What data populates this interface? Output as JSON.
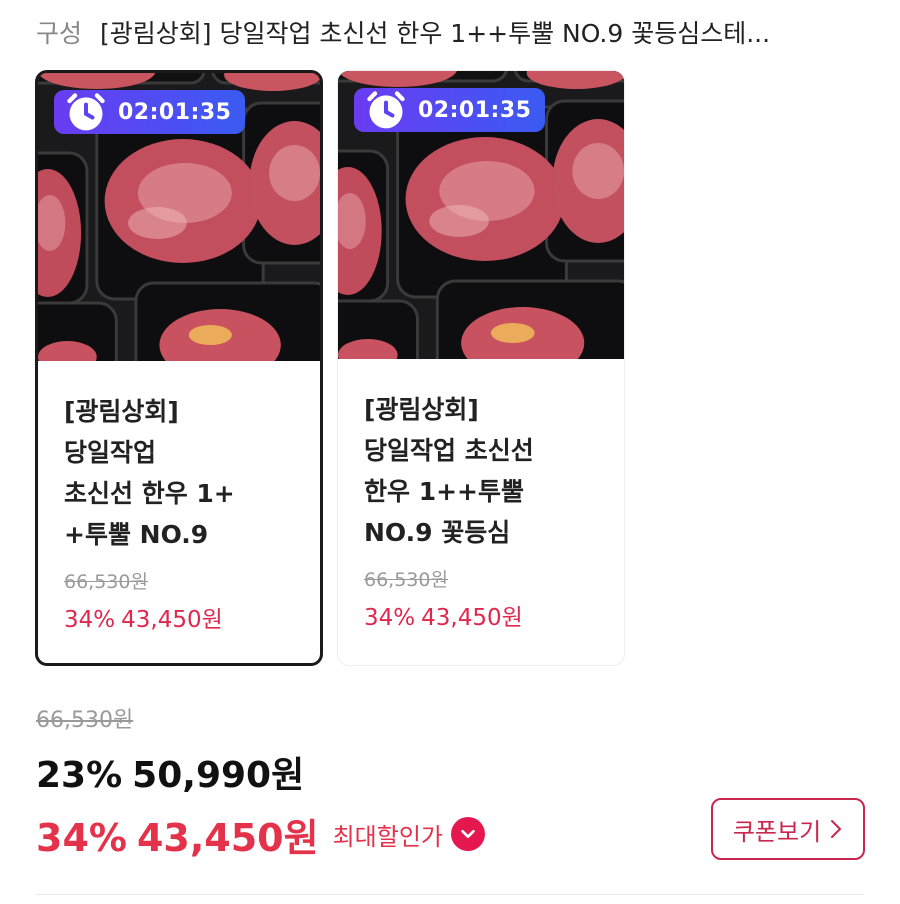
{
  "header": {
    "label": "구성",
    "title": "[광림상회] 당일작업 초신선 한우 1++투뿔 NO.9 꽃등심스테..."
  },
  "options": [
    {
      "timer": "02:01:35",
      "title_lines": [
        "[광림상회]",
        "당일작업",
        "초신선 한우 1+",
        "+투뿔 NO.9"
      ],
      "original_price": "66,530원",
      "discount_pct": "34%",
      "sale_price": "43,450원"
    },
    {
      "timer": "02:01:35",
      "title_lines": [
        "[광림상회]",
        "당일작업 초신선",
        "한우 1++투뿔",
        "NO.9 꽃등심"
      ],
      "original_price": "66,530원",
      "discount_pct": "34%",
      "sale_price": "43,450원"
    }
  ],
  "pricing": {
    "original_price": "66,530원",
    "discount_pct": "23%",
    "price": "50,990원",
    "max_discount_pct": "34%",
    "max_price": "43,450원",
    "max_label": "최대할인가",
    "coupon_button": "쿠폰보기"
  },
  "icons": {
    "timer": "alarm-clock-icon",
    "max_badge": "heart-chevron-icon",
    "coupon": "chevron-right-icon"
  },
  "colors": {
    "accent_red": "#e4324a",
    "coupon_border": "#c9274e",
    "timer_gradient_start": "#6a3cf2",
    "timer_gradient_end": "#3a5bf2",
    "heart_badge": "#e5174f"
  }
}
